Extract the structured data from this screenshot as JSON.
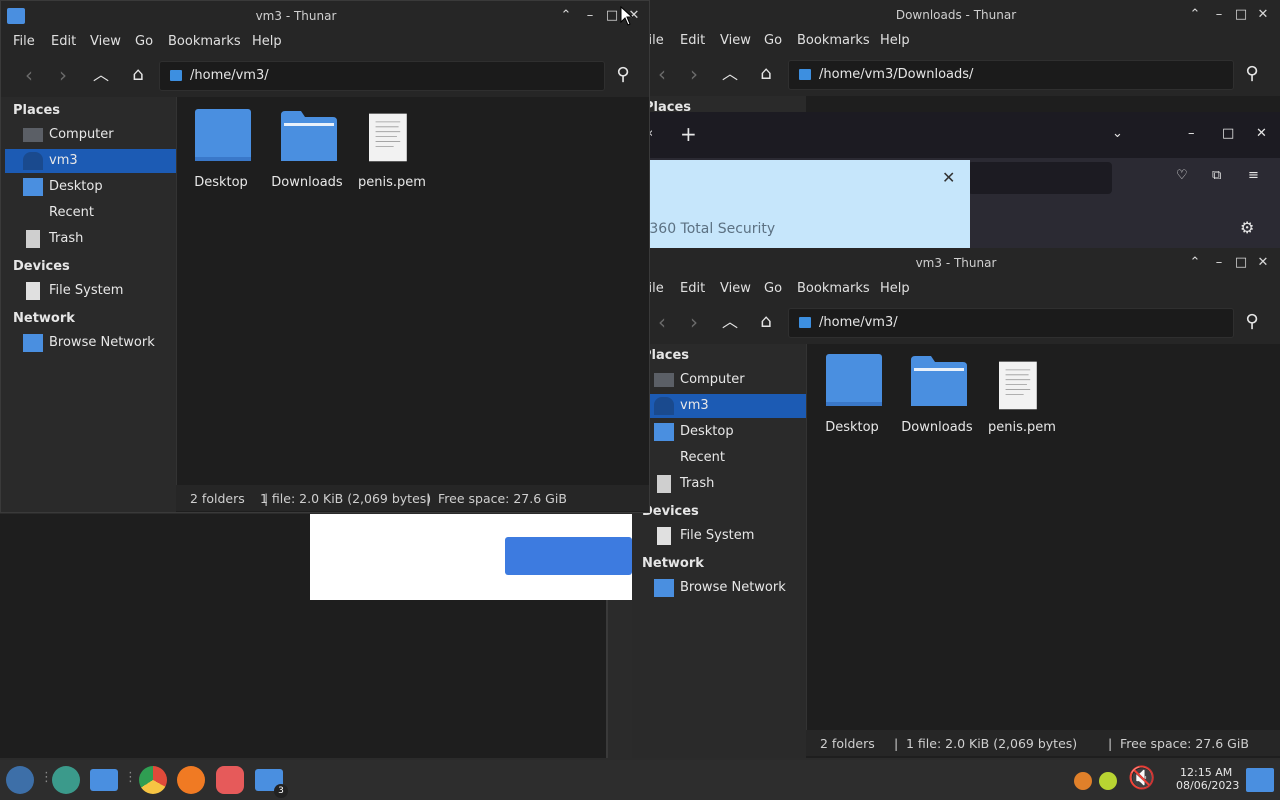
{
  "windows": {
    "front": {
      "title": "vm3 - Thunar",
      "menu": [
        "File",
        "Edit",
        "View",
        "Go",
        "Bookmarks",
        "Help"
      ],
      "path": "/home/vm3/",
      "places_header": "Places",
      "places": [
        "Computer",
        "vm3",
        "Desktop",
        "Recent",
        "Trash"
      ],
      "devices_header": "Devices",
      "devices": [
        "File System"
      ],
      "network_header": "Network",
      "network": [
        "Browse Network"
      ],
      "files": [
        "Desktop",
        "Downloads",
        "penis.pem"
      ],
      "status": {
        "folders": "2 folders",
        "files": "1 file: 2.0 KiB (2,069 bytes)",
        "free": "Free space: 27.6 GiB",
        "sep": "|"
      }
    },
    "downloads": {
      "title": "Downloads - Thunar",
      "menu": [
        "File",
        "Edit",
        "View",
        "Go",
        "Bookmarks",
        "Help"
      ],
      "path": "/home/vm3/Downloads/",
      "places_header": "Places"
    },
    "browser": {
      "new_tab": "+",
      "banner_text": "f 360 Total Security"
    },
    "back": {
      "title": "vm3 - Thunar",
      "menu": [
        "File",
        "Edit",
        "View",
        "Go",
        "Bookmarks",
        "Help"
      ],
      "path": "/home/vm3/",
      "places_header": "Places",
      "places": [
        "Computer",
        "vm3",
        "Desktop",
        "Recent",
        "Trash"
      ],
      "devices_header": "Devices",
      "devices": [
        "File System"
      ],
      "network_header": "Network",
      "network": [
        "Browse Network"
      ],
      "files": [
        "Desktop",
        "Downloads",
        "penis.pem"
      ],
      "status": {
        "folders": "2 folders",
        "files": "1 file: 2.0 KiB (2,069 bytes)",
        "free": "Free space: 27.6 GiB",
        "sep": "|"
      }
    }
  },
  "taskbar": {
    "time": "12:15 AM",
    "date": "08/06/2023",
    "badge": "3"
  },
  "colors": {
    "accent": "#1c5bb4",
    "folder": "#4a8fe0",
    "folder_dark": "#3a78c9"
  }
}
